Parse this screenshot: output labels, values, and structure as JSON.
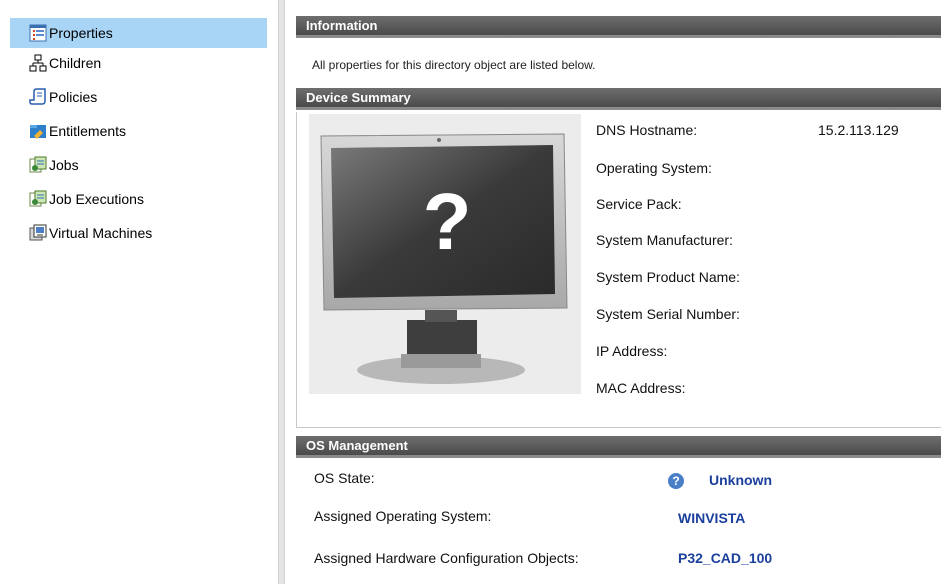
{
  "sidebar": {
    "items": [
      {
        "label": "Properties",
        "icon": "properties-icon",
        "active": true
      },
      {
        "label": "Children",
        "icon": "children-icon"
      },
      {
        "label": "Policies",
        "icon": "policies-icon"
      },
      {
        "label": "Entitlements",
        "icon": "entitlements-icon"
      },
      {
        "label": "Jobs",
        "icon": "jobs-icon"
      },
      {
        "label": "Job Executions",
        "icon": "job-executions-icon"
      },
      {
        "label": "Virtual Machines",
        "icon": "virtual-machines-icon"
      }
    ]
  },
  "information": {
    "title": "Information",
    "text": "All properties for this directory object are listed below."
  },
  "device_summary": {
    "title": "Device Summary",
    "image_glyph": "?",
    "properties": [
      {
        "label": "DNS Hostname:",
        "value": "15.2.113.129"
      },
      {
        "label": "Operating System:",
        "value": ""
      },
      {
        "label": "Service Pack:",
        "value": ""
      },
      {
        "label": "System Manufacturer:",
        "value": ""
      },
      {
        "label": "System Product Name:",
        "value": ""
      },
      {
        "label": "System Serial Number:",
        "value": ""
      },
      {
        "label": "IP Address:",
        "value": ""
      },
      {
        "label": "MAC Address:",
        "value": ""
      }
    ]
  },
  "os_management": {
    "title": "OS Management",
    "rows": [
      {
        "label": "OS State:",
        "value": "Unknown"
      },
      {
        "label": "Assigned Operating System:",
        "value": "WINVISTA"
      },
      {
        "label": "Assigned Hardware Configuration Objects:",
        "value": "P32_CAD_100"
      }
    ]
  },
  "colors": {
    "nav_active_bg": "#a8d4f5",
    "header_bg": "#555555",
    "link": "#1a3f9c"
  }
}
